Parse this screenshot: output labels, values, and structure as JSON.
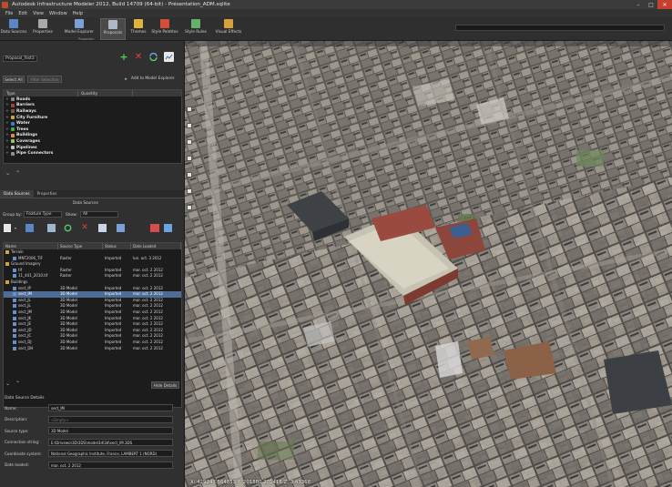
{
  "window": {
    "title": "Autodesk Infrastructure Modeler 2012, Build 14709 (64-bit) - Présentation_ADM.sqlite",
    "minimize": "–",
    "maximize": "□",
    "close": "✕"
  },
  "menu": [
    "File",
    "Edit",
    "View",
    "Window",
    "Help"
  ],
  "ribbon": {
    "buttons": [
      {
        "label": "Data Sources",
        "color": "#5b86c6"
      },
      {
        "label": "Properties",
        "color": "#a9a9a9"
      },
      {
        "label": "Model Explorer",
        "color": "#7aa0d6"
      },
      {
        "label": "Proposals",
        "color": "#b0b8c8"
      },
      {
        "label": "Themes",
        "color": "#e0b23a"
      },
      {
        "label": "Style Palettes",
        "color": "#d44c3a"
      },
      {
        "label": "Style Rules",
        "color": "#67b06a"
      },
      {
        "label": "Visual Effects",
        "color": "#d6a13a"
      }
    ],
    "group_label": "Proposals"
  },
  "model_explorer": {
    "proposal_value": "Proposal_Test3",
    "select_all": "Select All",
    "filter_selection": "Filter Selection",
    "add_to_model_explorer": "Add to Model Explorer",
    "columns": [
      "Type",
      "Quantity"
    ],
    "items": [
      {
        "label": "Roads",
        "color": "#8a8a8a"
      },
      {
        "label": "Barriers",
        "color": "#b04040"
      },
      {
        "label": "Railways",
        "color": "#7a5a3a"
      },
      {
        "label": "City Furniture",
        "color": "#c9a64a"
      },
      {
        "label": "Water",
        "color": "#3a7fd0"
      },
      {
        "label": "Trees",
        "color": "#3fae4a"
      },
      {
        "label": "Buildings",
        "color": "#d9904a"
      },
      {
        "label": "Coverages",
        "color": "#9ac44a"
      },
      {
        "label": "Pipelines",
        "color": "#c0c0c0"
      },
      {
        "label": "Pipe Connectors",
        "color": "#909090"
      }
    ]
  },
  "data_sources": {
    "tabs": [
      "Data Sources",
      "Properties"
    ],
    "data_sources_tab": "Data Sources",
    "group_by_label": "Group by:",
    "group_by_value": "Feature Type",
    "show_label": "Show:",
    "show_value": "All",
    "columns": [
      "Name",
      "Source Type",
      "Status",
      "Date Loaded"
    ],
    "rows": [
      {
        "name": "Terrain",
        "type": "",
        "status": "",
        "date": "",
        "group": true,
        "indent": 0
      },
      {
        "name": "MNT2006_TIF",
        "type": "Raster",
        "status": "Imported",
        "date": "lun. oct. 3 2012",
        "group": false,
        "indent": 1
      },
      {
        "name": "Ground Imagery",
        "type": "",
        "status": "",
        "date": "",
        "group": true,
        "indent": 0
      },
      {
        "name": "tif",
        "type": "Raster",
        "status": "Imported",
        "date": "mar. oct. 2 2012",
        "group": false,
        "indent": 1
      },
      {
        "name": "11_441_2010.tif",
        "type": "Raster",
        "status": "Imported",
        "date": "mar. oct. 2 2012",
        "group": false,
        "indent": 1
      },
      {
        "name": "Buildings",
        "type": "",
        "status": "",
        "date": "",
        "group": true,
        "indent": 0
      },
      {
        "name": "sect_IP",
        "type": "3D Model",
        "status": "Imported",
        "date": "mar. oct. 2 2012",
        "group": false,
        "indent": 1
      },
      {
        "name": "sect_IM",
        "type": "3D Model",
        "status": "Imported",
        "date": "mar. oct. 2 2012",
        "group": false,
        "indent": 1,
        "selected": true
      },
      {
        "name": "sect_JL",
        "type": "3D Model",
        "status": "Imported",
        "date": "mar. oct. 2 2012",
        "group": false,
        "indent": 1
      },
      {
        "name": "sect_JL",
        "type": "3D Model",
        "status": "Imported",
        "date": "mar. oct. 2 2012",
        "group": false,
        "indent": 1
      },
      {
        "name": "sect_JM",
        "type": "3D Model",
        "status": "Imported",
        "date": "mar. oct. 2 2012",
        "group": false,
        "indent": 1
      },
      {
        "name": "sect_JK",
        "type": "3D Model",
        "status": "Imported",
        "date": "mar. oct. 2 2012",
        "group": false,
        "indent": 1
      },
      {
        "name": "sect_JE",
        "type": "3D Model",
        "status": "Imported",
        "date": "mar. oct. 2 2012",
        "group": false,
        "indent": 1
      },
      {
        "name": "sect_JD",
        "type": "3D Model",
        "status": "Imported",
        "date": "mar. oct. 2 2012",
        "group": false,
        "indent": 1
      },
      {
        "name": "sect_JC",
        "type": "3D Model",
        "status": "Imported",
        "date": "mar. oct. 2 2012",
        "group": false,
        "indent": 1
      },
      {
        "name": "sect_DJ",
        "type": "3D Model",
        "status": "Imported",
        "date": "mar. oct. 2 2012",
        "group": false,
        "indent": 1
      },
      {
        "name": "sect_DH",
        "type": "3D Model",
        "status": "Imported",
        "date": "mar. oct. 2 2012",
        "group": false,
        "indent": 1
      }
    ],
    "hide_details": "Hide Details"
  },
  "details": {
    "title": "Data Source Details",
    "fields": [
      {
        "label": "Name:",
        "value": "sect_IM",
        "placeholder": false
      },
      {
        "label": "Description:",
        "value": "<Empty>",
        "placeholder": true
      },
      {
        "label": "Source type:",
        "value": "3D Model",
        "placeholder": false
      },
      {
        "label": "Connection string:",
        "value": "E:\\Drivewo\\3D\\3DS\\model3d\\3d\\sect_IM.3DS",
        "placeholder": false
      },
      {
        "label": "Coordinate system:",
        "value": "National Geographic Institute, France, LAMBERT 1 (NORD)",
        "placeholder": false
      },
      {
        "label": "Date loaded:",
        "value": "mar. oct. 2 2012",
        "placeholder": false
      }
    ]
  },
  "viewport": {
    "coords": "X: 429243.564853  Y: 201880.201416  Z: 3.43368"
  }
}
